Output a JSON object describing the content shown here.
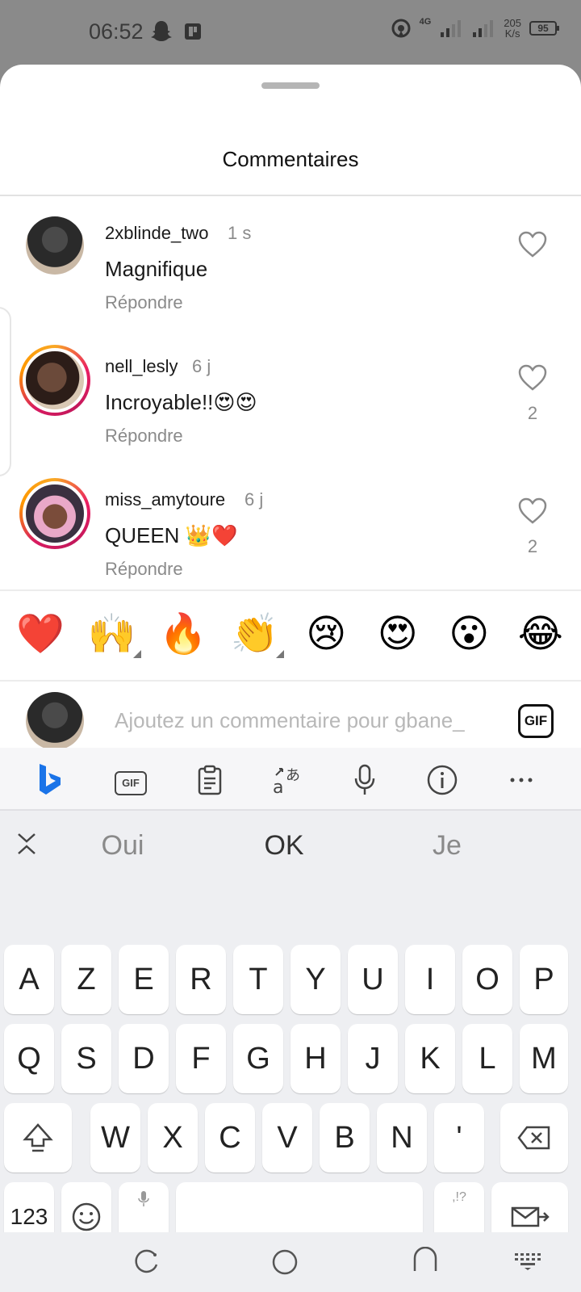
{
  "status": {
    "time": "06:52",
    "network": "4G",
    "speed_value": "205",
    "speed_unit": "K/s",
    "battery": "95"
  },
  "sheet": {
    "title": "Commentaires"
  },
  "comments": [
    {
      "user": "2xblinde_two",
      "time": "1 s",
      "text": "Magnifique",
      "reply": "Répondre",
      "likes": ""
    },
    {
      "user": "nell_lesly",
      "time": "6 j",
      "text": "Incroyable!!😍😍",
      "reply": "Répondre",
      "likes": "2"
    },
    {
      "user": "miss_amytoure",
      "time": "6 j",
      "text": "QUEEN 👑❤️",
      "reply": "Répondre",
      "likes": "2"
    }
  ],
  "reactions": [
    "❤️",
    "🙌",
    "🔥",
    "👏",
    "😢",
    "😍",
    "😮",
    "😂"
  ],
  "composer": {
    "placeholder": "Ajoutez un commentaire pour gbane_",
    "gif_label": "GIF"
  },
  "keyboard": {
    "toolbar_gif": "GIF",
    "suggestions": [
      "Oui",
      "OK",
      "Je"
    ],
    "row1": [
      "A",
      "Z",
      "E",
      "R",
      "T",
      "Y",
      "U",
      "I",
      "O",
      "P"
    ],
    "row2": [
      "Q",
      "S",
      "D",
      "F",
      "G",
      "H",
      "J",
      "K",
      "L",
      "M"
    ],
    "row3": [
      "W",
      "X",
      "C",
      "V",
      "B",
      "N",
      "'"
    ],
    "numbers_label": "123",
    "comma": ",",
    "period": ".",
    "period_sub": ",!?"
  },
  "colors": {
    "accent_story_ring": "#e91e63",
    "muted_text": "#8a8a8a",
    "sheet_bg": "#ffffff",
    "keyboard_bg": "#eeeff2"
  }
}
